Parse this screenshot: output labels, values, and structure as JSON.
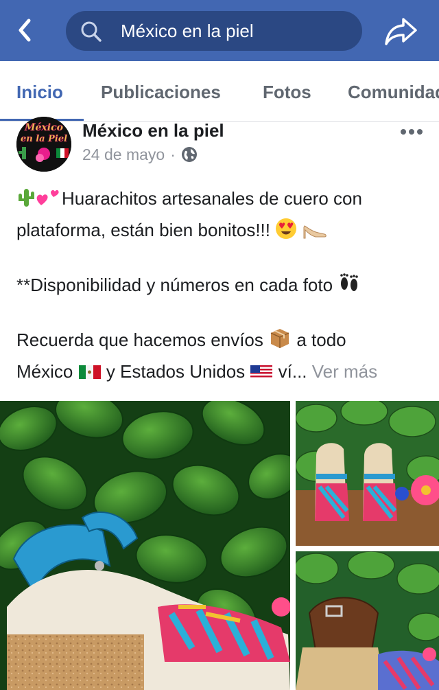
{
  "header": {
    "search_text": "México en la piel",
    "back_icon": "chevron-left-icon",
    "search_icon": "search-icon",
    "share_icon": "share-icon",
    "bar_color": "#4267b2"
  },
  "tabs": [
    {
      "label": "Inicio",
      "active": true
    },
    {
      "label": "Publicaciones",
      "active": false
    },
    {
      "label": "Fotos",
      "active": false
    },
    {
      "label": "Comunidad",
      "active": false
    }
  ],
  "post": {
    "page_name": "México en la piel",
    "date": "24 de mayo",
    "separator": "·",
    "privacy_icon": "globe-icon",
    "avatar_text": [
      "México",
      "en la Piel"
    ],
    "lines": {
      "line1": "Huarachitos artesanales de cuero con",
      "line2": "plataforma, están bien bonitos!!!",
      "line3": "**Disponibilidad y números en cada foto",
      "line4": "Recuerda que hacemos envíos",
      "line4b": "a todo",
      "line5a": "México",
      "line5b": "y Estados Unidos",
      "line5c": "ví...",
      "see_more": "Ver más"
    },
    "photos": [
      {
        "name": "photo-main-sandal-turquoise"
      },
      {
        "name": "photo-sandals-pair-colorful"
      },
      {
        "name": "photo-sandal-brown"
      }
    ]
  }
}
